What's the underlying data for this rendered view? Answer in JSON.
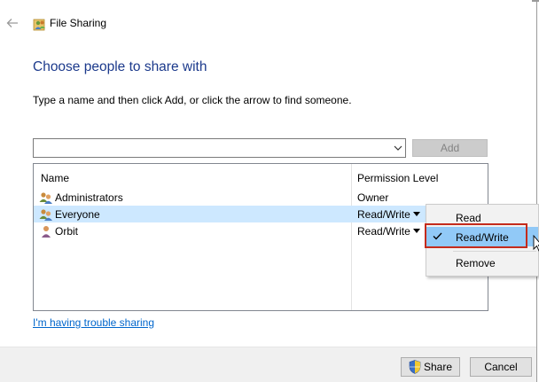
{
  "window": {
    "title": "File Sharing"
  },
  "heading": "Choose people to share with",
  "instructions": "Type a name and then click Add, or click the arrow to find someone.",
  "name_input": {
    "value": "",
    "placeholder": ""
  },
  "add_button": {
    "label": "Add",
    "enabled": false
  },
  "list": {
    "columns": [
      "Name",
      "Permission Level"
    ],
    "rows": [
      {
        "name": "Administrators",
        "permission": "Owner",
        "icon": "group-users-icon",
        "has_dropdown": false,
        "selected": false
      },
      {
        "name": "Everyone",
        "permission": "Read/Write",
        "icon": "group-users-icon",
        "has_dropdown": true,
        "selected": true
      },
      {
        "name": "Orbit",
        "permission": "Read/Write",
        "icon": "user-icon",
        "has_dropdown": true,
        "selected": false
      }
    ]
  },
  "permission_menu": {
    "items": [
      {
        "label": "Read",
        "checked": false
      },
      {
        "label": "Read/Write",
        "checked": true,
        "highlighted": true
      },
      {
        "label": "Remove",
        "checked": false
      }
    ]
  },
  "trouble_link": "I'm having trouble sharing",
  "footer": {
    "share_label": "Share",
    "cancel_label": "Cancel"
  },
  "colors": {
    "heading": "#1c3a8c",
    "link": "#0066cc",
    "selected_row": "#cde8ff",
    "menu_highlight": "#91c9f7",
    "annotation_box": "#c42b1c"
  },
  "icons": {
    "back": "back-arrow-icon",
    "title": "file-sharing-icon",
    "share_shield": "uac-shield-icon",
    "menu_check": "checkmark-icon"
  }
}
